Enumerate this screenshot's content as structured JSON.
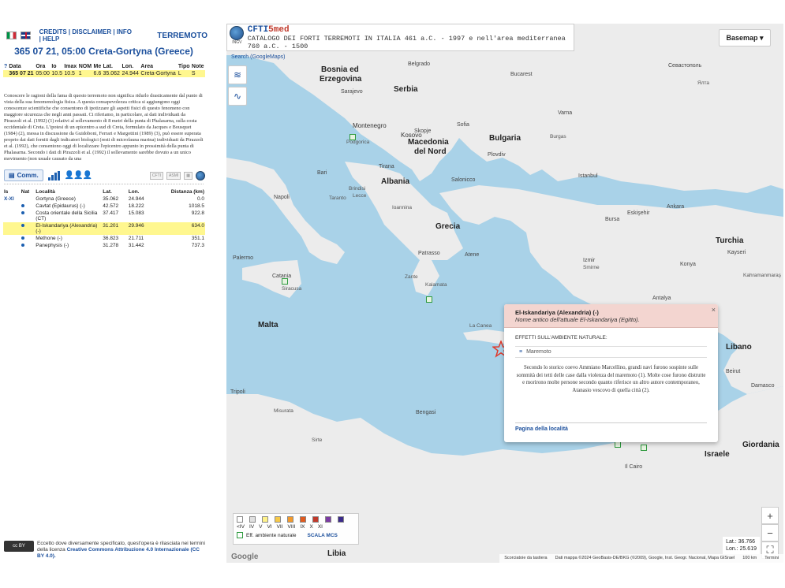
{
  "left": {
    "nav": {
      "links": "CREDITS | DISCLAIMER | INFO | HELP",
      "section": "TERREMOTO"
    },
    "quake_title": "365 07 21, 05:00 Creta-Gortyna (Greece)",
    "eq_table": {
      "headers": [
        "?",
        "Data",
        "Ora",
        "Io",
        "Imax",
        "NOM",
        "Me",
        "Lat.",
        "Lon.",
        "Area",
        "Tipo",
        "Note"
      ],
      "row": [
        "365 07 21",
        "05:00",
        "10.5",
        "10.5",
        "1",
        "6.6",
        "35.062",
        "24.944",
        "Creta-Gortyna",
        "L",
        "S"
      ]
    },
    "paragraph": "Conoscere le ragioni della fama di questo terremoto non significa ridurlo drasticamente dal punto di vista della sua fenomenologia fisica. A questa consapevolezza critica si aggiungono oggi conoscenze scientifiche che consentono di ipotizzare gli aspetti fisici di questo fenomeno con maggiore sicurezza che negli anni passati. Ci riferiamo, in particolare, ai dati individuati da Pirazzoli et al. (1992) (1) relativi al sollevamento di 8 metri della punta di Phalasarna, sulla costa occidentale di Creta. L'ipotesi di un epicentro a sud di Creta, formulato da Jacques e Bousquet (1984) (2), messa in discussione da Guidoboni, Ferrari e Margottini (1989) (3), può essere superata proprio dai dati forniti dagli indicatori biologici (resti di microfauna marina) individuati da Pirazzoli et al. (1992), che consentono oggi di localizzare l'epicentro appunto in prossimità della punta di Phalasarna. Secondo i dati di Pirazzoli et al. (1992) il sollevamento sarebbe dovuto a un unico movimento (non usuale causato da una",
    "comm_button": "Comm.",
    "loc_table": {
      "headers": [
        "Is",
        "Nat",
        "Località",
        "Lat.",
        "Lon.",
        "Distanza (km)"
      ],
      "rows": [
        {
          "is": "X-XI",
          "loc": "Gortyna (Greece)",
          "lat": "35.062",
          "lon": "24.944",
          "dist": "0.0"
        },
        {
          "is": "",
          "loc": "Cavtat (Epidaurus) (-)",
          "lat": "42.572",
          "lon": "18.222",
          "dist": "1018.5"
        },
        {
          "is": "",
          "loc": "Costa orientale della Sicilia (CT)",
          "lat": "37.417",
          "lon": "15.083",
          "dist": "922.8"
        },
        {
          "is": "",
          "loc": "El-Iskandariya (Alexandria) (-)",
          "lat": "31.201",
          "lon": "29.946",
          "dist": "634.0"
        },
        {
          "is": "",
          "loc": "Methone (-)",
          "lat": "36.823",
          "lon": "21.711",
          "dist": "351.1"
        },
        {
          "is": "",
          "loc": "Panephysis (-)",
          "lat": "31.278",
          "lon": "31.442",
          "dist": "737.3"
        }
      ]
    },
    "footer_text": "Eccetto dove diversamente specificato, quest'opera è rilasciata nei termini della licenza ",
    "footer_link": "Creative Commons Attribuzione 4.0 Internazionale (CC BY 4.0)."
  },
  "map": {
    "header": {
      "ingv": "INGV",
      "cfti_prefix": "CFTI",
      "cfti_suffix": "5med",
      "catalog": "CATALOGO DEI FORTI TERREMOTI IN ITALIA 461 a.C. - 1997 e nell'area mediterranea 760 a.C. - 1500"
    },
    "search": "Search (GoogleMaps)",
    "basemap": "Basemap",
    "labels": {
      "bosnia": "Bosnia ed",
      "erzegovina": "Erzegovina",
      "serbia": "Serbia",
      "montenegro": "Montenegro",
      "kosovo": "Kosovo",
      "bulgaria": "Bulgaria",
      "macedonia": "Macedonia",
      "delnord": "del Nord",
      "albania": "Albania",
      "grecia": "Grecia",
      "turchia": "Turchia",
      "malta": "Malta",
      "libano": "Libano",
      "israele": "Israele",
      "giordania": "Giordania",
      "libia": "Libia",
      "sarajevo": "Sarajevo",
      "belgrado": "Belgrado",
      "sofia": "Sofia",
      "bucarest": "Bucarest",
      "tirana": "Tirana",
      "skopje": "Skopje",
      "salonicco": "Salonicco",
      "istanbul": "Istanbul",
      "ankara": "Ankara",
      "atene": "Atene",
      "napoli": "Napoli",
      "bari": "Bari",
      "palermo": "Palermo",
      "catania": "Catania",
      "siracusa": "Siracusa",
      "tripoli": "Tripoli",
      "bengasi": "Bengasi",
      "bursa": "Bursa",
      "izmir": "Izmir",
      "antalya": "Antalya",
      "konya": "Konya",
      "kayseri": "Kayseri",
      "beirut": "Beirut",
      "damasco": "Damasco",
      "cairo": "Il Cairo",
      "patrasso": "Patrasso",
      "ioannina": "Ioannina",
      "lacanea": "La Canea",
      "plovdiv": "Plovdiv",
      "varna": "Varna",
      "eskisehir": "Eskişehir",
      "sevastopol": "Севастополь",
      "yalta": "Ялта",
      "misurata": "Misurata",
      "sirte": "Sirte",
      "podgorica": "Podgorica",
      "taranto": "Taranto",
      "lecce": "Lecce",
      "brindisi": "Brindisi",
      "kalamata": "Kalamata",
      "zante": "Zante",
      "burgas": "Burgas",
      "smirne": "Smirne",
      "kahramanmaras": "Kahramanmaraş"
    },
    "popup": {
      "title": "El-Iskandariya (Alexandria) (-)",
      "subtitle": "Nome antico dell'attuale El-Iskandariya (Egitto).",
      "effects_header": "EFFETTI SULL'AMBIENTE NATURALE:",
      "effect": "Maremoto",
      "text": "Secondo lo storico coevo Ammiano Marcellino, grandi navi furono sospinte sulle sommità dei tetti delle case dalla violenza del maremoto (1). Molte cose furono distrutte e morirono molte persone secondo quanto riferisce un altro autore contemporaneo, Atanasio vescovo di quella città (2).",
      "link": "Pagina della località",
      "close": "×"
    },
    "legend": {
      "levels": [
        "<IV",
        "IV",
        "V",
        "VI",
        "VII",
        "VIII",
        "IX",
        "X",
        "XI"
      ],
      "colors": [
        "#ffffff",
        "#e0e0e0",
        "#fff28a",
        "#f7c948",
        "#f39a2c",
        "#e05a1e",
        "#c0392b",
        "#7b3aa3",
        "#3b2a8a"
      ],
      "eff_label": "Eff. ambiente naturale",
      "scala": "SCALA MCS"
    },
    "coords": {
      "lat": "Lat.: 36.766",
      "lon": "Lon.: 25.619"
    },
    "attrib": [
      "Scorciatoie da tastiera",
      "Dati mappa ©2024 GeoBasis-DE/BKG (©2009), Google, Inst. Geogr. Nacional, Mapa GISrael",
      "100 km",
      "Termini"
    ],
    "google": "Google"
  }
}
